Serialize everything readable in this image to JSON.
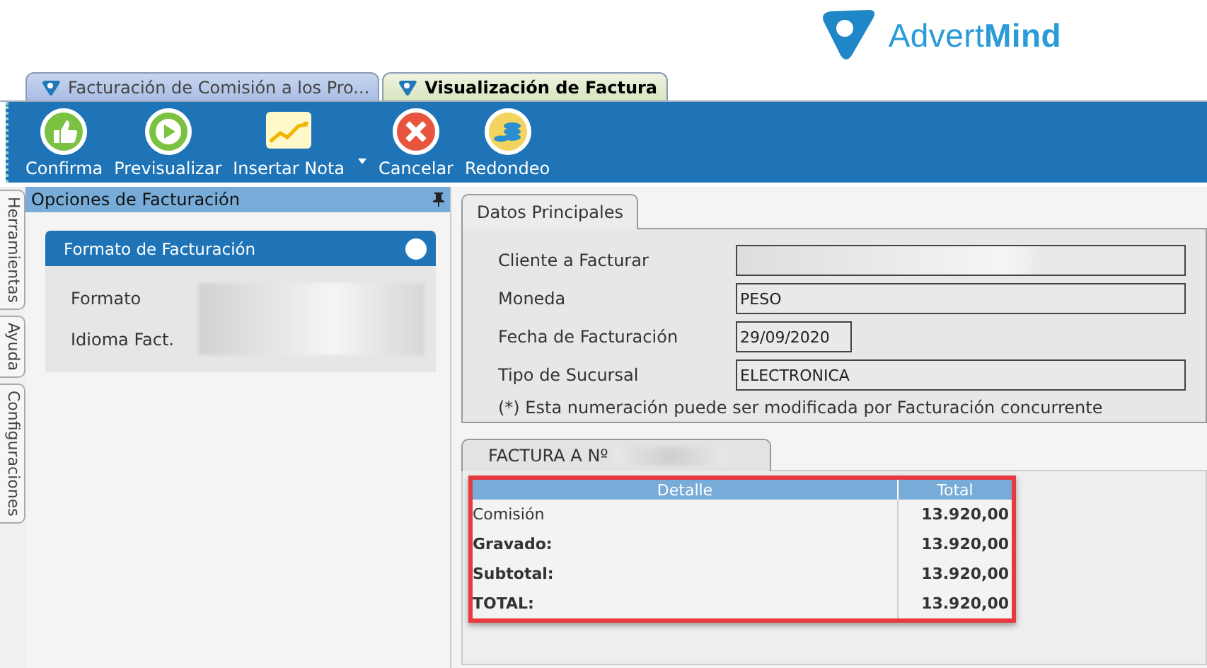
{
  "brand": {
    "logo_text": "Advert**Mind**"
  },
  "document_tabs": [
    {
      "label": "Facturación de Comisión a los Pro...",
      "selected": false
    },
    {
      "label": "Visualización de Factura",
      "selected": true
    }
  ],
  "toolbar": [
    {
      "label": "Confirma",
      "kind": "thumbs",
      "has_menu": false
    },
    {
      "label": "Previsualizar",
      "kind": "play",
      "has_menu": false
    },
    {
      "label": "Insertar Nota",
      "kind": "chart",
      "has_menu": true
    },
    {
      "label": "Cancelar",
      "kind": "cancel",
      "has_menu": false
    },
    {
      "label": "Redondeo",
      "kind": "coins",
      "has_menu": false
    }
  ],
  "side_tabs": [
    {
      "label": "Herramientas"
    },
    {
      "label": "Ayuda"
    },
    {
      "label": "Configuraciones"
    }
  ],
  "options_panel": {
    "title": "Opciones de Facturación",
    "section": {
      "title": "Formato de Facturación",
      "fields": [
        {
          "label": "Formato"
        },
        {
          "label": "Idioma Fact."
        }
      ]
    }
  },
  "main_tab": {
    "label": "Datos Principales"
  },
  "form": [
    {
      "label": "Cliente a Facturar",
      "kind": "redacted"
    },
    {
      "label": "Moneda",
      "kind": "text",
      "value": "PESO"
    },
    {
      "label": "Fecha de Facturación",
      "kind": "date",
      "value": "29/09/2020"
    },
    {
      "label": "Tipo de Sucursal",
      "kind": "text",
      "value": "ELECTRONICA"
    }
  ],
  "note": "(*) Esta numeración puede ser modificada por Facturación concurrente",
  "invoice_tab": {
    "label": "FACTURA A Nº"
  },
  "invoice_table": {
    "columns": [
      "Detalle",
      "Total"
    ],
    "rows": [
      {
        "detail": "Comisión",
        "total": "13.920,00",
        "bold": false
      },
      {
        "detail": "Gravado:",
        "total": "13.920,00",
        "bold": true
      },
      {
        "detail": "Subtotal:",
        "total": "13.920,00",
        "bold": true
      },
      {
        "detail": "TOTAL:",
        "total": "13.920,00",
        "bold": true
      }
    ]
  }
}
